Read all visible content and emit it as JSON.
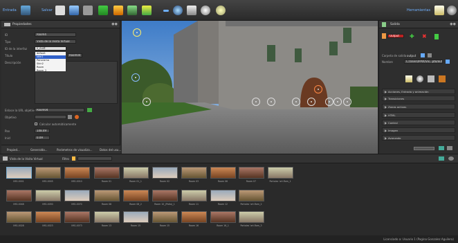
{
  "toolbar": {
    "file_label": "Entrada",
    "save_label": "Salvar",
    "tools_label": "Herramientas"
  },
  "properties": {
    "title": "Propiedades",
    "id_label": "ID",
    "id_value": "Room4",
    "type_label": "Tipo",
    "type_value": "Vista de la Visita Virtual",
    "interface_label": "ID de la interfaz",
    "interface_value": "s_cust",
    "interface_options": [
      "default",
      "skin1",
      "Panorama",
      "Skin2",
      "Room",
      "Room_2"
    ],
    "title_label": "Título",
    "title_value": "Room04",
    "desc_label": "Descripción",
    "url_label": "Enlace la URL objetivo",
    "url_value": "Room04",
    "target_label": "Objetivo",
    "auto_label": "Calcular automáticamente",
    "pan_label": "Pan",
    "pan_value": "148.49",
    "tilt_label": "Inicl",
    "tilt_value": "0.09",
    "tabs": [
      "Propied...",
      "Generalda...",
      "Parámetros de visualiza...",
      "Datos del usu..."
    ]
  },
  "right_panel": {
    "title": "Salida",
    "output_value": "Output",
    "output_folder_label": "Carpeta de salida",
    "output_folder_value": "output",
    "file_label": "Nombre",
    "file_value": "C:/Users/PPIX/Vis...pto/output",
    "sections": [
      "Acciones, Entrada y animación",
      "Transiciones",
      "Zonas activas",
      "HTML",
      "Control",
      "Imagen",
      "Avanzado"
    ]
  },
  "thumbs_bar": {
    "tour_label": "Vista de la Visita Virtual",
    "filter_label": "Filtro"
  },
  "thumbnails": [
    [
      "IMG-0001",
      "IMG-0005",
      "IMG-0010",
      "Room 01",
      "Room 01_1",
      "Room 02",
      "Room 03",
      "Room 06",
      "Room 07",
      "Portales ‘art.Rom_1"
    ],
    [
      "IMG-0048",
      "IMG-0050",
      "IMG-0070",
      "Room 08",
      "Room 08_2",
      "Room 10_(Patio)_1",
      "Room 11",
      "Room 12",
      "Portales ‘art.Rom_2"
    ],
    [
      "IMG-0028",
      "IMG-0023",
      "IMG-0073",
      "Room 13",
      "Room 15",
      "Room 15",
      "Room 16",
      "Room 16_1",
      "Portales ‘art.Rom_3"
    ]
  ],
  "status": "Licenciado a: Usuario 1 (Pagina Gonzalez Aguilera)"
}
